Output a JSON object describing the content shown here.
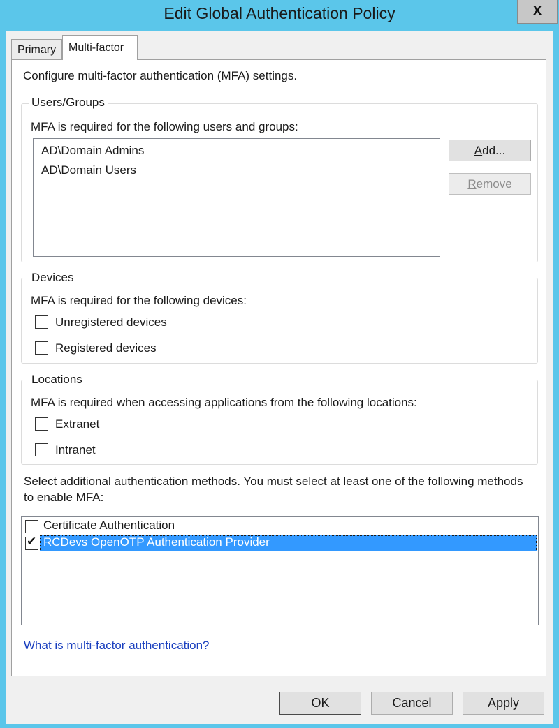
{
  "window": {
    "title": "Edit Global Authentication Policy",
    "close_icon": "close-icon",
    "close_glyph": "X"
  },
  "tabs": [
    {
      "label": "Primary",
      "active": false
    },
    {
      "label": "Multi-factor",
      "active": true
    }
  ],
  "intro_text": "Configure multi-factor authentication (MFA) settings.",
  "users_groups": {
    "legend": "Users/Groups",
    "description": "MFA is required for the following users and groups:",
    "items": [
      "AD\\Domain Admins",
      "AD\\Domain Users"
    ],
    "add_button": {
      "mnemonic": "A",
      "rest": "dd..."
    },
    "remove_button": {
      "mnemonic": "R",
      "rest": "emove",
      "enabled": false
    }
  },
  "devices": {
    "legend": "Devices",
    "description": "MFA is required for the following devices:",
    "options": [
      {
        "label": "Unregistered devices",
        "checked": false
      },
      {
        "label": "Registered devices",
        "checked": false
      }
    ]
  },
  "locations": {
    "legend": "Locations",
    "description": "MFA is required when accessing applications from the following locations:",
    "options": [
      {
        "label": "Extranet",
        "checked": false
      },
      {
        "label": "Intranet",
        "checked": false
      }
    ]
  },
  "methods": {
    "description_line1": "Select additional authentication methods. You must select at least one of the following methods",
    "description_line2": "to enable MFA:",
    "items": [
      {
        "label": "Certificate Authentication",
        "checked": false,
        "selected": false
      },
      {
        "label": "RCDevs OpenOTP Authentication Provider",
        "checked": true,
        "selected": true
      }
    ]
  },
  "help_link": "What is multi-factor authentication?",
  "footer": {
    "ok": "OK",
    "cancel": "Cancel",
    "apply": "Apply"
  },
  "colors": {
    "window_border": "#5bc6ea",
    "selection": "#3399ff",
    "link": "#1a3fbf"
  }
}
